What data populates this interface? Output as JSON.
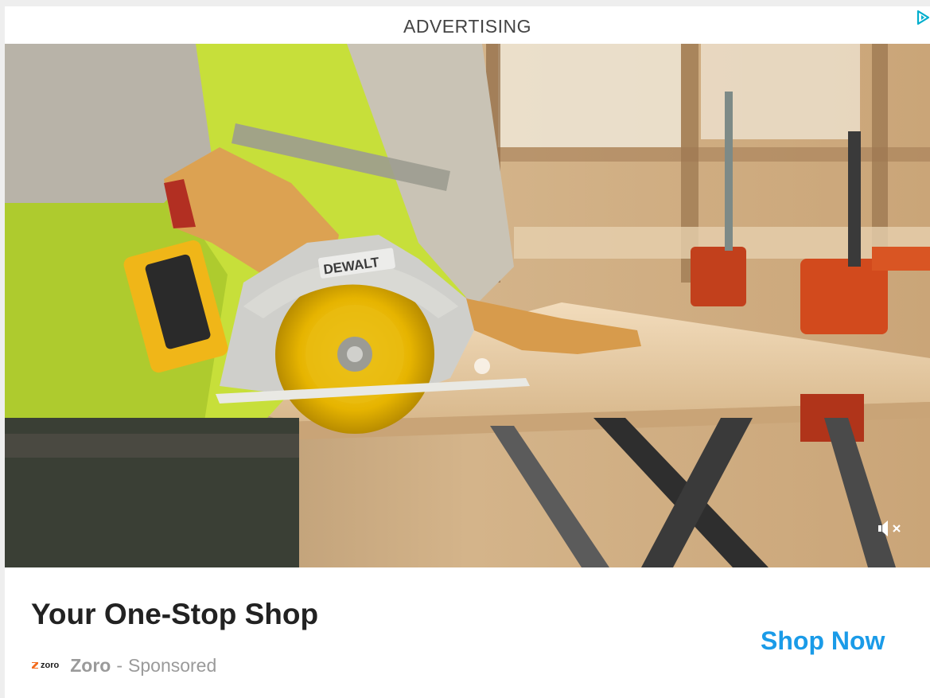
{
  "ad": {
    "label": "ADVERTISING",
    "headline": "Your One-Stop Shop",
    "advertiser": "Zoro",
    "separator": "-",
    "sponsored": "Sponsored",
    "cta": "Shop Now",
    "logo_text": "zoro",
    "saw_brand_text": "DEWALT"
  },
  "icons": {
    "adchoices": "adchoices-icon",
    "mute": "speaker-muted-icon",
    "logo": "zoro-logo-icon"
  },
  "colors": {
    "cta": "#1a9be8",
    "headline": "#222222",
    "meta": "#9a9a9a",
    "adchoices": "#00aecd",
    "saw_yellow": "#f2c100"
  }
}
